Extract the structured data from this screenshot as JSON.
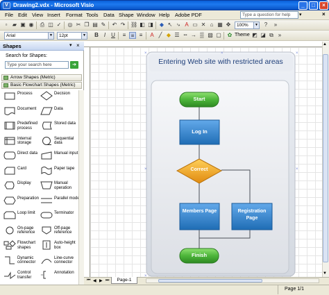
{
  "window": {
    "title": "Drawing2.vdx - Microsoft Visio"
  },
  "menu": {
    "items": [
      "File",
      "Edit",
      "View",
      "Insert",
      "Format",
      "Tools",
      "Data",
      "Shape",
      "Window",
      "Help",
      "Adobe PDF"
    ],
    "help_placeholder": "Type a question for help"
  },
  "toolbar": {
    "font_name": "Arial",
    "font_size": "12pt",
    "zoom": "100%",
    "theme_label": "Theme"
  },
  "shapes_pane": {
    "title": "Shapes",
    "search_label": "Search for Shapes:",
    "search_placeholder": "Type your search here",
    "stencils": [
      "Arrow Shapes (Metric)",
      "Basic Flowchart Shapes (Metric)"
    ],
    "items": [
      {
        "label": "Process",
        "icon": "process-icon"
      },
      {
        "label": "Decision",
        "icon": "decision-icon"
      },
      {
        "label": "Document",
        "icon": "document-icon"
      },
      {
        "label": "Data",
        "icon": "data-icon"
      },
      {
        "label": "Predefined process",
        "icon": "predefined-process-icon"
      },
      {
        "label": "Stored data",
        "icon": "stored-data-icon"
      },
      {
        "label": "Internal storage",
        "icon": "internal-storage-icon"
      },
      {
        "label": "Sequential data",
        "icon": "sequential-data-icon"
      },
      {
        "label": "Direct data",
        "icon": "direct-data-icon"
      },
      {
        "label": "Manual input",
        "icon": "manual-input-icon"
      },
      {
        "label": "Card",
        "icon": "card-icon"
      },
      {
        "label": "Paper tape",
        "icon": "paper-tape-icon"
      },
      {
        "label": "Display",
        "icon": "display-icon"
      },
      {
        "label": "Manual operation",
        "icon": "manual-operation-icon"
      },
      {
        "label": "Preparation",
        "icon": "preparation-icon"
      },
      {
        "label": "Parallel mode",
        "icon": "parallel-mode-icon"
      },
      {
        "label": "Loop limit",
        "icon": "loop-limit-icon"
      },
      {
        "label": "Terminator",
        "icon": "terminator-icon"
      },
      {
        "label": "On-page reference",
        "icon": "on-page-reference-icon"
      },
      {
        "label": "Off-page reference",
        "icon": "off-page-reference-icon"
      },
      {
        "label": "Flowchart shapes",
        "icon": "flowchart-shapes-icon"
      },
      {
        "label": "Auto-height box",
        "icon": "auto-height-box-icon"
      },
      {
        "label": "Dynamic connector",
        "icon": "dynamic-connector-icon"
      },
      {
        "label": "Line-curve connector",
        "icon": "line-curve-connector-icon"
      },
      {
        "label": "Control transfer",
        "icon": "control-transfer-icon"
      },
      {
        "label": "Annotation",
        "icon": "annotation-icon"
      }
    ]
  },
  "diagram": {
    "title": "Entering Web site with restricted areas",
    "nodes": {
      "start": "Start",
      "login": "Log In",
      "correct": "Correct",
      "members": "Members Page",
      "registration": "Registration Page",
      "finish": "Finish"
    },
    "colors": {
      "terminator": "#4db53a",
      "process": "#2f86cf",
      "decision": "#f0a31a"
    }
  },
  "status": {
    "page_tab": "Page-1",
    "page_indicator": "Page 1/1"
  }
}
